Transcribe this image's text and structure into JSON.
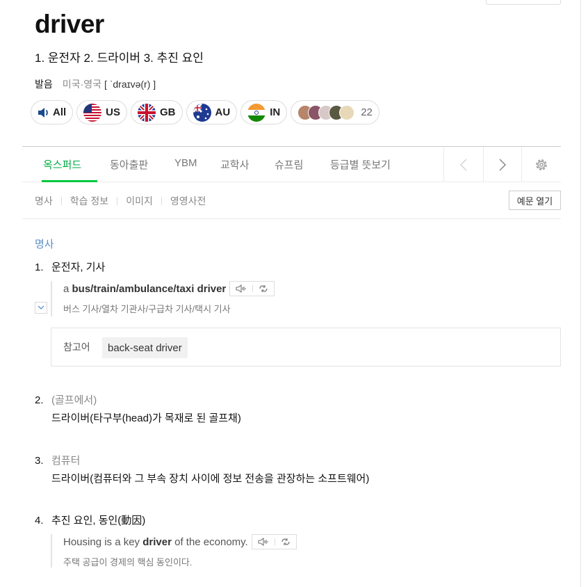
{
  "entry": {
    "word": "driver",
    "meanings": "1. 운전자 2. 드라이버 3. 추진 요인",
    "pron_label": "발음",
    "pron_region": "미국·영국",
    "pron_ipa": "[ ˈdraɪvə(r) ]"
  },
  "audio_chips": [
    {
      "label": "All",
      "icon": "speaker-icon"
    },
    {
      "label": "US",
      "icon": "us-flag-icon"
    },
    {
      "label": "GB",
      "icon": "gb-flag-icon"
    },
    {
      "label": "AU",
      "icon": "au-flag-icon"
    },
    {
      "label": "IN",
      "icon": "in-flag-icon"
    }
  ],
  "user_pron_count": "22",
  "tabs": [
    {
      "label": "옥스퍼드",
      "active": true
    },
    {
      "label": "동아출판"
    },
    {
      "label": "YBM"
    },
    {
      "label": "교학사"
    },
    {
      "label": "슈프림"
    },
    {
      "label": "등급별 뜻보기"
    }
  ],
  "subnav": [
    "명사",
    "학습 정보",
    "이미지",
    "영영사전"
  ],
  "example_toggle": "예문 열기",
  "pos": "명사",
  "senses": [
    {
      "num": "1.",
      "title": "운전자, 기사",
      "example_pre": "a ",
      "example_bold": "bus/train/ambulance/taxi driver",
      "example_post": "",
      "example_ko": "버스 기사/열차 기관사/구급차 기사/택시 기사",
      "ref_label": "참고어",
      "ref_word": "back-seat driver"
    },
    {
      "num": "2.",
      "domain": "(골프에서)",
      "definition": "드라이버(타구부(head)가 목재로 된 골프채)"
    },
    {
      "num": "3.",
      "domain": "컴퓨터",
      "definition": "드라이버(컴퓨터와 그 부속 장치 사이에 정보 전송을 관장하는 소프트웨어)"
    },
    {
      "num": "4.",
      "title": "추진 요인, 동인(動因)",
      "example_pre": "Housing is a key ",
      "example_bold": "driver",
      "example_post": " of the economy.",
      "example_ko": "주택 공급이 경제의 핵심 동인이다."
    }
  ],
  "colors": {
    "accent_green": "#00a843",
    "pos_blue": "#5b8fc9",
    "gray_text": "#888888"
  }
}
